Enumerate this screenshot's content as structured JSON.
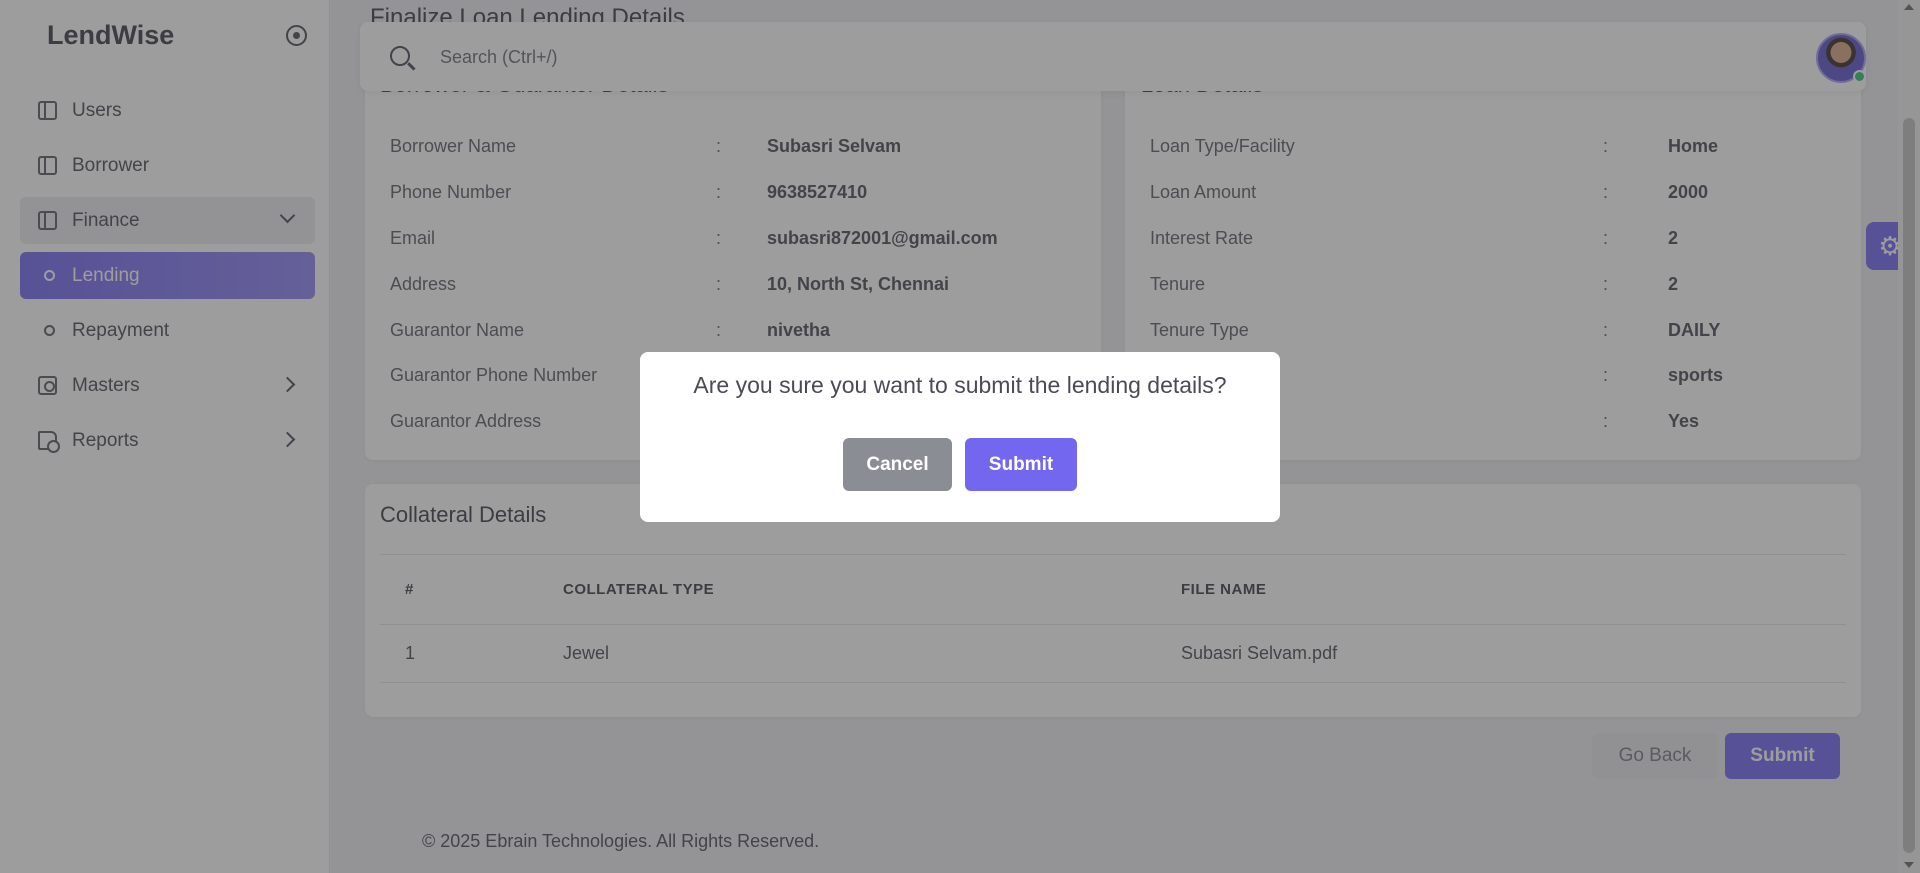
{
  "app": {
    "brand": "LendWise"
  },
  "sidebar": {
    "items": [
      {
        "label": "Users"
      },
      {
        "label": "Borrower"
      },
      {
        "label": "Finance"
      },
      {
        "label": "Lending"
      },
      {
        "label": "Repayment"
      },
      {
        "label": "Masters"
      },
      {
        "label": "Reports"
      }
    ]
  },
  "page": {
    "title": "Finalize Loan Lending Details"
  },
  "search": {
    "placeholder": "Search (Ctrl+/)"
  },
  "borrower_card": {
    "title": "Borrower & Guarantor Details",
    "rows": [
      {
        "label": "Borrower Name",
        "value": "Subasri Selvam"
      },
      {
        "label": "Phone Number",
        "value": "9638527410"
      },
      {
        "label": "Email",
        "value": "subasri872001@gmail.com"
      },
      {
        "label": "Address",
        "value": "10, North St, Chennai"
      },
      {
        "label": "Guarantor Name",
        "value": "nivetha"
      },
      {
        "label": "Guarantor Phone Number",
        "value": ""
      },
      {
        "label": "Guarantor Address",
        "value": ""
      }
    ]
  },
  "loan_card": {
    "title": "Loan Details",
    "rows": [
      {
        "label": "Loan Type/Facility",
        "value": "Home"
      },
      {
        "label": "Loan Amount",
        "value": "2000"
      },
      {
        "label": "Interest Rate",
        "value": "2"
      },
      {
        "label": "Tenure",
        "value": "2"
      },
      {
        "label": "Tenure Type",
        "value": "DAILY"
      },
      {
        "label": "",
        "value": "sports"
      },
      {
        "label": "",
        "value": "Yes"
      }
    ]
  },
  "collateral": {
    "title": "Collateral Details",
    "headers": [
      "#",
      "COLLATERAL TYPE",
      "FILE NAME"
    ],
    "rows": [
      [
        "1",
        "Jewel",
        "Subasri Selvam.pdf"
      ]
    ]
  },
  "actions": {
    "go_back": "Go Back",
    "submit": "Submit"
  },
  "footer": {
    "text": "© 2025 Ebrain Technologies. All Rights Reserved."
  },
  "modal": {
    "message": "Are you sure you want to submit the lending details?",
    "cancel": "Cancel",
    "submit": "Submit"
  },
  "colors": {
    "primary": "#7367f0",
    "online": "#28c76f"
  }
}
